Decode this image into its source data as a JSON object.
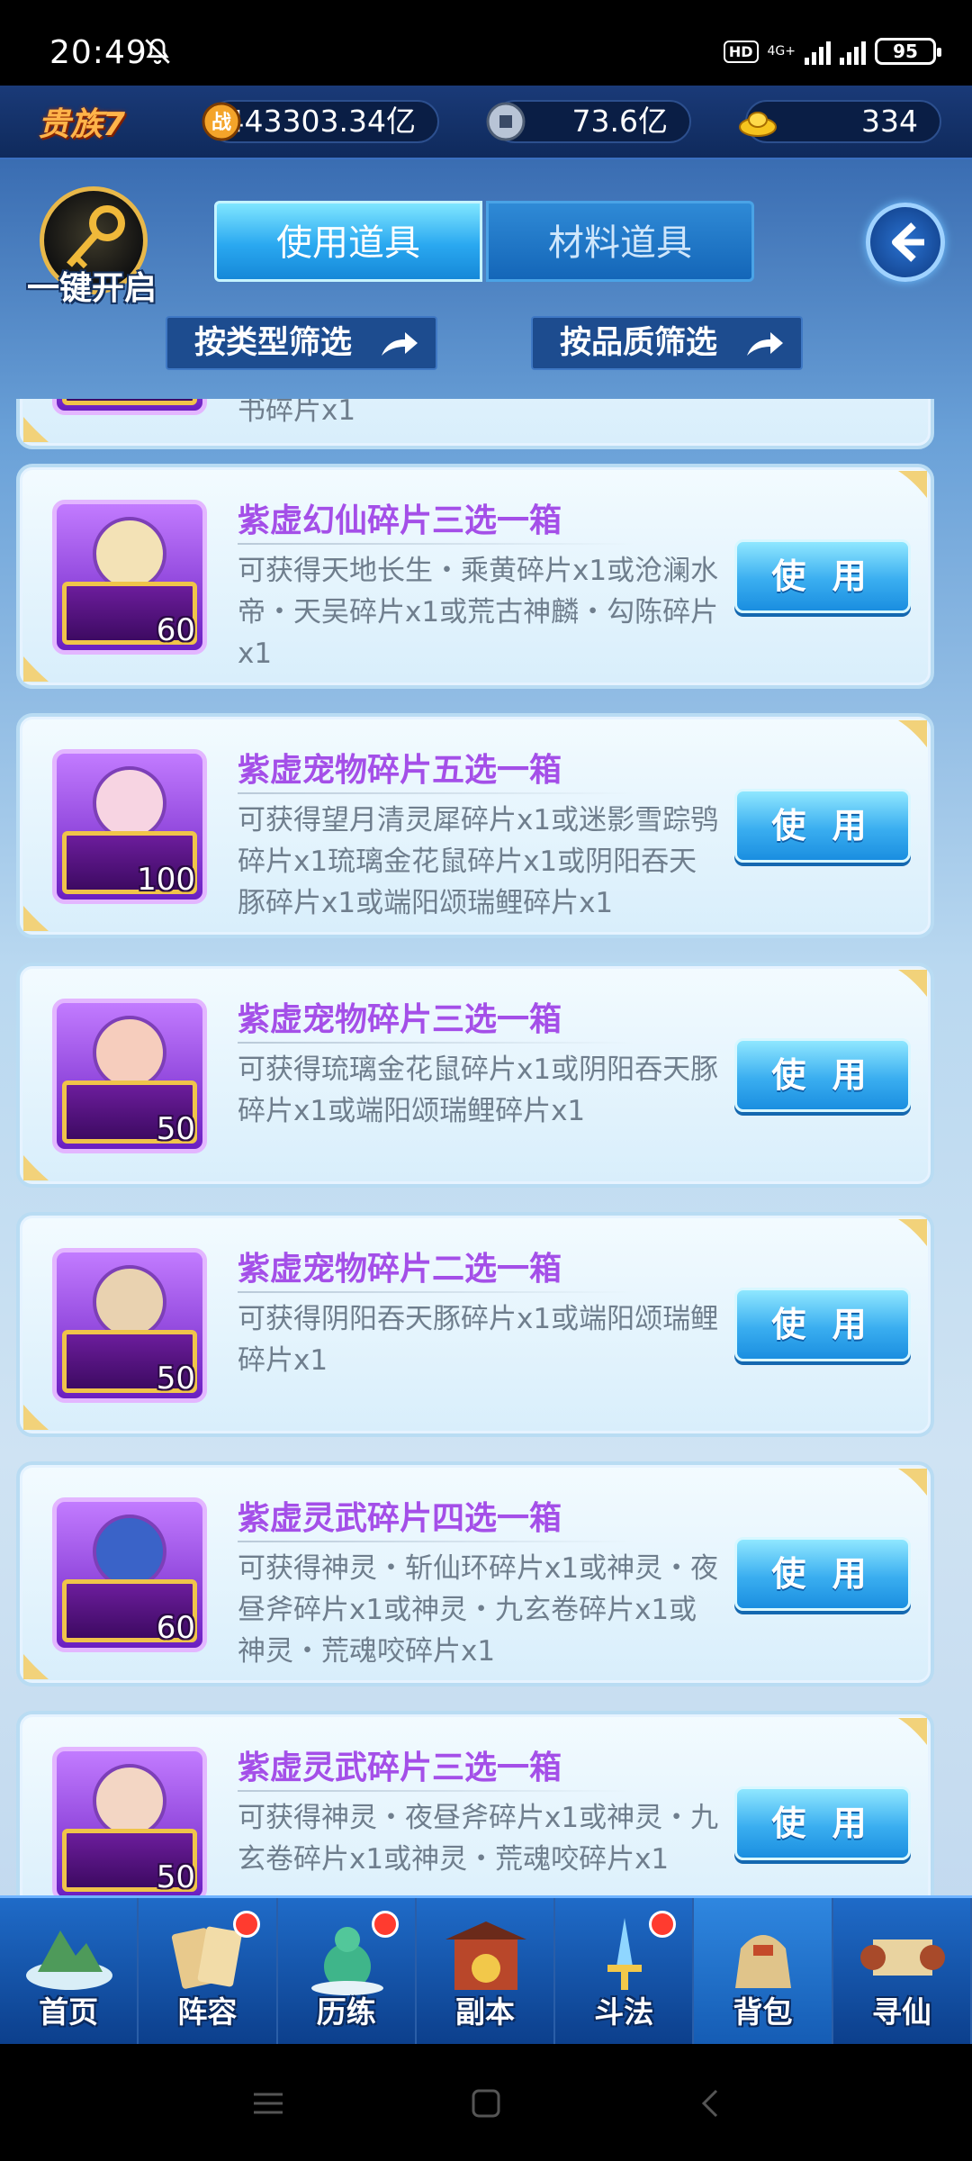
{
  "status": {
    "time": "20:49",
    "hd": "HD",
    "net": "4G+",
    "battery": "95"
  },
  "resources": {
    "vip": "贵族7",
    "combat_badge": "战",
    "combat_power": "443303.34亿",
    "coins": "73.6亿",
    "gold": "334"
  },
  "key_open_label": "一键开启",
  "tabs": [
    {
      "label": "使用道具",
      "active": true
    },
    {
      "label": "材料道具",
      "active": false
    }
  ],
  "filters": {
    "by_type": "按类型筛选",
    "by_quality": "按品质筛选"
  },
  "partial_item": {
    "desc_tail": "书碎片x1"
  },
  "items": [
    {
      "title": "紫虚幻仙碎片三选一箱",
      "desc": "可获得天地长生・乘黄碎片x1或沧澜水帝・天吴碎片x1或荒古神麟・勾陈碎片x1",
      "qty": "60",
      "button": "使 用"
    },
    {
      "title": "紫虚宠物碎片五选一箱",
      "desc": "可获得望月清灵犀碎片x1或迷影雪踪鸮碎片x1琉璃金花鼠碎片x1或阴阳吞天豚碎片x1或端阳颂瑞鲤碎片x1",
      "qty": "100",
      "button": "使 用"
    },
    {
      "title": "紫虚宠物碎片三选一箱",
      "desc": "可获得琉璃金花鼠碎片x1或阴阳吞天豚碎片x1或端阳颂瑞鲤碎片x1",
      "qty": "50",
      "button": "使 用"
    },
    {
      "title": "紫虚宠物碎片二选一箱",
      "desc": "可获得阴阳吞天豚碎片x1或端阳颂瑞鲤碎片x1",
      "qty": "50",
      "button": "使 用"
    },
    {
      "title": "紫虚灵武碎片四选一箱",
      "desc": "可获得神灵・斩仙环碎片x1或神灵・夜昼斧碎片x1或神灵・九玄卷碎片x1或神灵・荒魂咬碎片x1",
      "qty": "60",
      "button": "使 用"
    },
    {
      "title": "紫虚灵武碎片三选一箱",
      "desc": "可获得神灵・夜昼斧碎片x1或神灵・九玄卷碎片x1或神灵・荒魂咬碎片x1",
      "qty": "50",
      "button": "使 用"
    }
  ],
  "nav": [
    {
      "label": "首页",
      "badge": false,
      "active": false
    },
    {
      "label": "阵容",
      "badge": true,
      "active": false
    },
    {
      "label": "历练",
      "badge": true,
      "active": false
    },
    {
      "label": "副本",
      "badge": false,
      "active": false
    },
    {
      "label": "斗法",
      "badge": true,
      "active": false
    },
    {
      "label": "背包",
      "badge": false,
      "active": true
    },
    {
      "label": "寻仙",
      "badge": false,
      "active": false
    }
  ],
  "colors": {
    "title_purple": "#a44fe8",
    "button_blue": "#3aaef0",
    "badge_red": "#ff3b2f"
  }
}
